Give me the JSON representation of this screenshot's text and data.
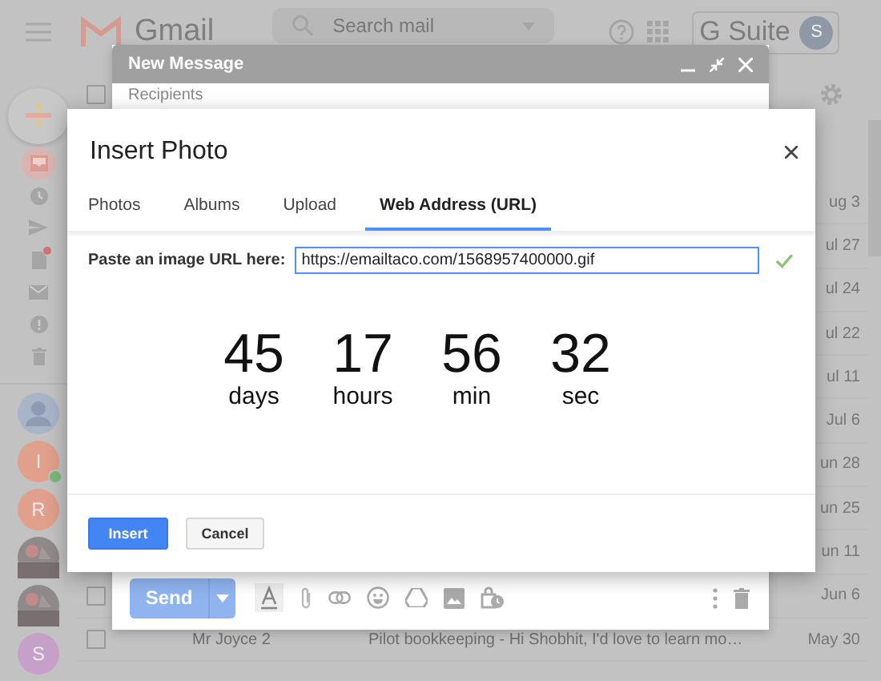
{
  "header": {
    "app_name": "Gmail",
    "search": {
      "placeholder": "Search mail"
    },
    "suite_label": "G Suite",
    "avatar_initial": "S"
  },
  "rail": {
    "nav": [
      {
        "kind": "inbox",
        "selected": true,
        "dot": false
      },
      {
        "kind": "clock",
        "selected": false,
        "dot": false
      },
      {
        "kind": "send",
        "selected": false,
        "dot": false
      },
      {
        "kind": "draft",
        "selected": false,
        "dot": true
      },
      {
        "kind": "mail",
        "selected": false,
        "dot": false
      },
      {
        "kind": "important",
        "selected": false,
        "dot": false
      },
      {
        "kind": "trash",
        "selected": false,
        "dot": false
      }
    ],
    "contacts": [
      {
        "kind": "silhouette",
        "online": false
      },
      {
        "kind": "initial",
        "initial": "I",
        "color": "#e0a08c",
        "online": true
      },
      {
        "kind": "initial",
        "initial": "R",
        "color": "#e0a08c",
        "online": false
      },
      {
        "kind": "picture",
        "online": false
      },
      {
        "kind": "picture",
        "online": false
      },
      {
        "kind": "initial",
        "initial": "S",
        "color": "#c7a0c9",
        "online": false
      }
    ]
  },
  "select_all": {
    "checked": false
  },
  "mail_rows": [
    {
      "date": "ug 3"
    },
    {
      "date": "ul 27"
    },
    {
      "date": "ul 24"
    },
    {
      "date": "ul 22"
    },
    {
      "date": "ul 11"
    },
    {
      "date": "Jul 6"
    },
    {
      "date": "un 28"
    },
    {
      "date": "un 25"
    },
    {
      "date": "un 11"
    },
    {
      "checked": false,
      "date": "Jun 6"
    },
    {
      "checked": false,
      "sender": "Mr Joyce 2",
      "subject": "Pilot bookkeeping - Hi Shobhit, I'd love to learn mo…",
      "date": "May 30"
    }
  ],
  "compose": {
    "title": "New Message",
    "recipients_placeholder": "Recipients",
    "send_label": "Send"
  },
  "dialog": {
    "title": "Insert Photo",
    "tabs": [
      {
        "label": "Photos",
        "selected": false
      },
      {
        "label": "Albums",
        "selected": false
      },
      {
        "label": "Upload",
        "selected": false
      },
      {
        "label": "Web Address (URL)",
        "selected": true
      }
    ],
    "url": {
      "label": "Paste an image URL here:",
      "value": "https://emailtaco.com/1568957400000.gif",
      "valid": true
    },
    "preview": [
      {
        "value": "45",
        "unit": "days"
      },
      {
        "value": "17",
        "unit": "hours"
      },
      {
        "value": "56",
        "unit": "min"
      },
      {
        "value": "32",
        "unit": "sec"
      }
    ],
    "buttons": [
      {
        "label": "Insert",
        "kind": "primary"
      },
      {
        "label": "Cancel",
        "kind": "secondary"
      }
    ]
  }
}
